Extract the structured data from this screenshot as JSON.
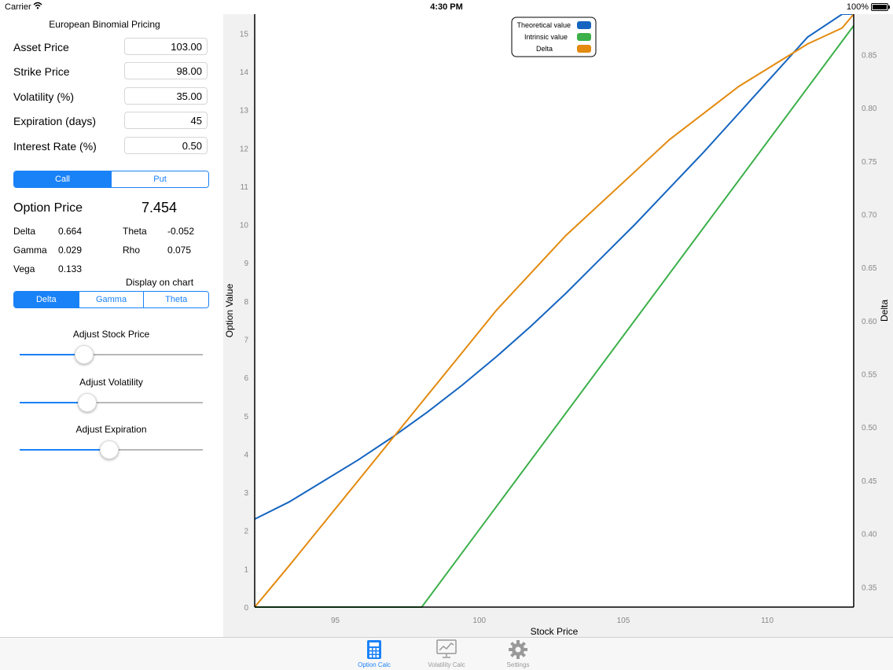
{
  "status": {
    "carrier": "Carrier",
    "time": "4:30 PM",
    "battery": "100%"
  },
  "panel": {
    "title": "European Binomial Pricing",
    "fields": [
      {
        "label": "Asset Price",
        "value": "103.00"
      },
      {
        "label": "Strike Price",
        "value": "98.00"
      },
      {
        "label": "Volatility (%)",
        "value": "35.00"
      },
      {
        "label": "Expiration (days)",
        "value": "45"
      },
      {
        "label": "Interest Rate (%)",
        "value": "0.50"
      }
    ],
    "type_segments": [
      "Call",
      "Put"
    ],
    "option_price_label": "Option Price",
    "option_price_value": "7.454",
    "greeks": {
      "delta_label": "Delta",
      "delta": "0.664",
      "theta_label": "Theta",
      "theta": "-0.052",
      "gamma_label": "Gamma",
      "gamma": "0.029",
      "rho_label": "Rho",
      "rho": "0.075",
      "vega_label": "Vega",
      "vega": "0.133"
    },
    "display_label": "Display on chart",
    "display_segments": [
      "Delta",
      "Gamma",
      "Theta"
    ],
    "sliders": [
      {
        "label": "Adjust Stock Price",
        "value": 0.35
      },
      {
        "label": "Adjust Volatility",
        "value": 0.37
      },
      {
        "label": "Adjust Expiration",
        "value": 0.49
      }
    ]
  },
  "chart_data": {
    "type": "line",
    "xlabel": "Stock Price",
    "ylabel": "Option Value",
    "y2label": "Delta",
    "xlim": [
      92.2,
      113.0
    ],
    "ylim": [
      0,
      15.5
    ],
    "y2lim": [
      0.331,
      0.888
    ],
    "xticks": [
      95,
      100,
      105,
      110
    ],
    "yticks": [
      0,
      1,
      2,
      3,
      4,
      5,
      6,
      7,
      8,
      9,
      10,
      11,
      12,
      13,
      14,
      15
    ],
    "y2ticks": [
      0.35,
      0.4,
      0.45,
      0.5,
      0.55,
      0.6,
      0.65,
      0.7,
      0.75,
      0.8,
      0.85
    ],
    "legend_position": "top-center",
    "series": [
      {
        "name": "Theoretical value",
        "color": "#1565c0",
        "axis": "left",
        "x": [
          92.2,
          93.4,
          94.6,
          95.8,
          97.0,
          98.2,
          99.4,
          100.6,
          101.8,
          103.0,
          104.2,
          105.4,
          106.6,
          107.8,
          109.0,
          110.2,
          111.4,
          112.6,
          113.0
        ],
        "y": [
          2.3,
          2.75,
          3.3,
          3.85,
          4.45,
          5.1,
          5.8,
          6.55,
          7.35,
          8.2,
          9.1,
          10.0,
          10.95,
          11.9,
          12.9,
          13.9,
          14.9,
          15.9,
          15.7
        ]
      },
      {
        "name": "Intrinsic value",
        "color": "#3cb04a",
        "axis": "left",
        "x": [
          92.2,
          98.0,
          113.0
        ],
        "y": [
          0,
          0,
          15.2
        ]
      },
      {
        "name": "Delta",
        "color": "#e38a0f",
        "axis": "right",
        "x": [
          92.2,
          93.4,
          94.6,
          95.8,
          97.0,
          98.2,
          99.4,
          100.6,
          101.8,
          103.0,
          104.2,
          105.4,
          106.6,
          107.8,
          109.0,
          110.2,
          111.4,
          112.6,
          113.0
        ],
        "y": [
          0.331,
          0.37,
          0.41,
          0.45,
          0.49,
          0.53,
          0.57,
          0.61,
          0.645,
          0.68,
          0.71,
          0.74,
          0.77,
          0.795,
          0.82,
          0.84,
          0.86,
          0.875,
          0.888
        ]
      }
    ]
  },
  "tabs": [
    {
      "label": "Option Calc",
      "icon": "calculator-icon",
      "active": true
    },
    {
      "label": "Volatility Calc",
      "icon": "chart-monitor-icon",
      "active": false
    },
    {
      "label": "Settings",
      "icon": "gear-icon",
      "active": false
    }
  ]
}
